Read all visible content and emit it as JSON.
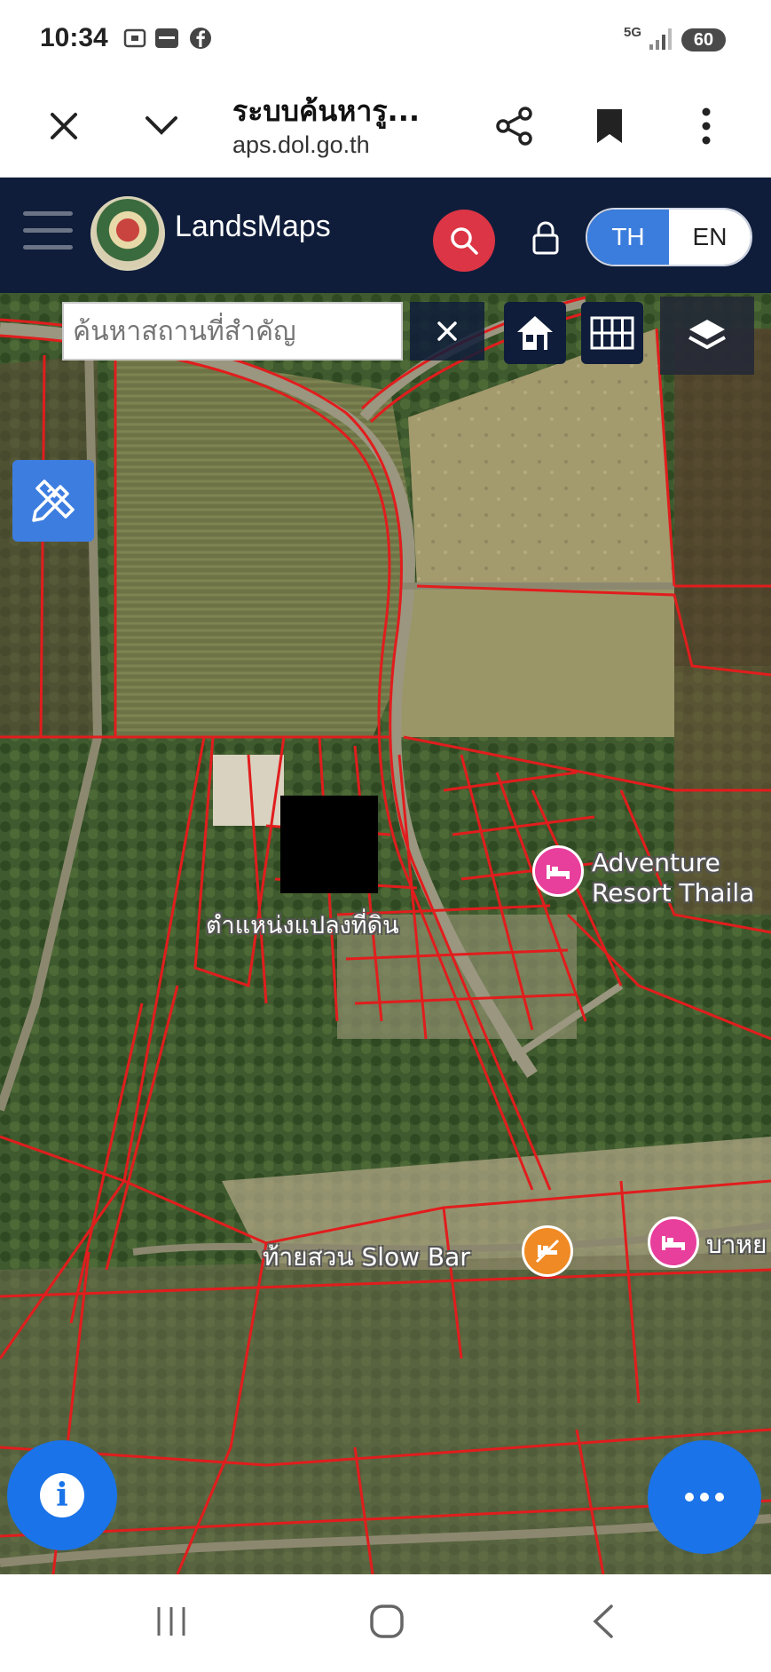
{
  "status_bar": {
    "time": "10:34",
    "network": "5G",
    "battery": "60",
    "icons": [
      "screenshot-icon",
      "app-icon",
      "facebook-icon",
      "signal-icon"
    ]
  },
  "browser": {
    "title": "ระบบค้นหารู...",
    "url": "aps.dol.go.th",
    "close_icon": "close-icon",
    "menu_icon": "chevron-down-icon",
    "share_icon": "share-icon",
    "bookmark_icon": "bookmark-icon",
    "more_icon": "more-vert-icon"
  },
  "app_header": {
    "brand": "LandsMaps",
    "lang_th": "TH",
    "lang_en": "EN",
    "search_color": "#dc3545",
    "active_lang_color": "#3b7ddd"
  },
  "map": {
    "search_placeholder": "ค้นหาสถานที่สำคัญ",
    "labels": {
      "parcel_position": "ตำแหน่งแปลงที่ดิน",
      "adventure_line1": "Adventure",
      "adventure_line2": "Resort Thaila",
      "slow_bar": "ท้ายสวน Slow Bar",
      "right_label": "บาหย"
    },
    "parcel_line_color": "#e11d1d"
  },
  "nav_bar": {
    "icons": [
      "recents-icon",
      "home-icon",
      "back-icon"
    ]
  }
}
